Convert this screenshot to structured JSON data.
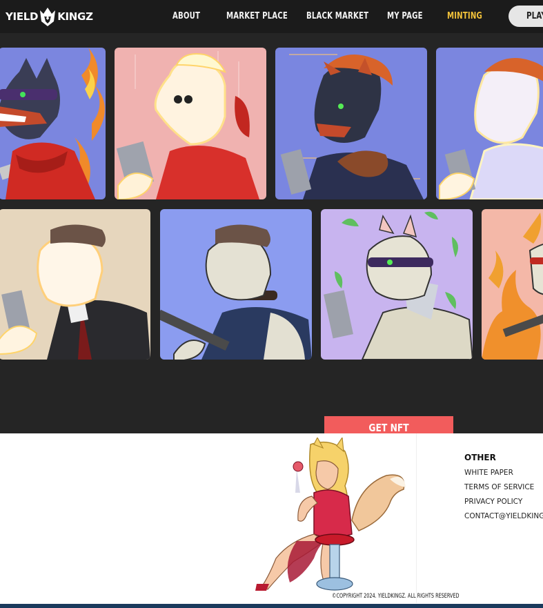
{
  "brand": {
    "left": "YIELD",
    "right": "KINGZ",
    "colors": {
      "header": "#1b1b1b",
      "background": "#252525",
      "accent": "#f25c5c",
      "active_nav": "#f2c23a"
    }
  },
  "nav": {
    "items": [
      {
        "label": "ABOUT"
      },
      {
        "label": "MARKET PLACE"
      },
      {
        "label": "BLACK MARKET"
      },
      {
        "label": "MY PAGE"
      },
      {
        "label": "MINTING",
        "active": true
      }
    ],
    "play_label": "PLAY"
  },
  "gallery": {
    "row1": [
      {
        "character": "doberman-red-jacket-fire",
        "bg": "#7a86e0"
      },
      {
        "character": "glowing-dog-red-jacket",
        "bg": "#f0b3b3"
      },
      {
        "character": "doberman-orange-hair-beads",
        "bg": "#7a86e0"
      },
      {
        "character": "glowing-dog-orange-hair",
        "bg": "#7a86e0"
      }
    ],
    "row2": [
      {
        "character": "glowing-weasel-suit-cap",
        "bg": "#e8d8c0"
      },
      {
        "character": "white-weasel-cap-rifle",
        "bg": "#8a9af0"
      },
      {
        "character": "white-weasel-mask-leaves",
        "bg": "#c9b5f0"
      },
      {
        "character": "fox-fire",
        "bg": "#f3b6a8"
      }
    ]
  },
  "cta": {
    "get_nft_label": "GET NFT"
  },
  "footer": {
    "other_heading": "OTHER",
    "links": [
      "WHITE PAPER",
      "TERMS OF SERVICE",
      "PRIVACY POLICY",
      "CONTACT@YIELDKING"
    ],
    "copyright": "©COPYRIGHT 2024. YIELDKINGZ. ALL RIGHTS RESERVED",
    "mascot": "fox-girl-on-barstool"
  }
}
